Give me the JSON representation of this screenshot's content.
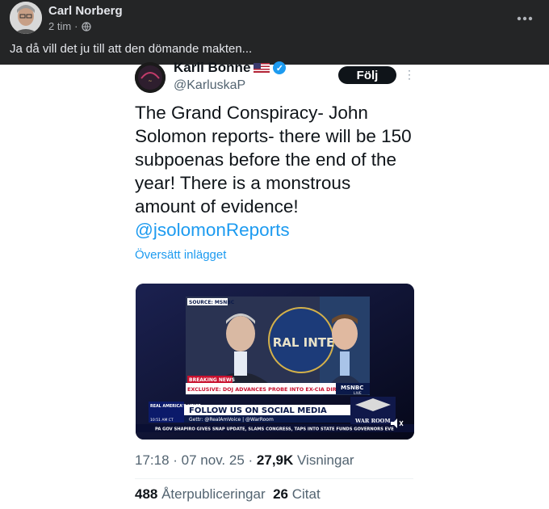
{
  "post": {
    "author": "Carl Norberg",
    "time": "2 tim",
    "separator": "·",
    "text": "Ja då vill det ju till att den dömande makten...",
    "more_icon": "more-horizontal-icon"
  },
  "tweet": {
    "display_name": "Karli Bonne",
    "handle": "@KarluskaP",
    "follow_label": "Följ",
    "body": "The Grand Conspiracy- John Solomon reports- there will be 150 subpoenas before the end of the year! There is a monstrous amount of evidence!",
    "mention": "@jsolomonReports",
    "translate_label": "Översätt inlägget",
    "timestamp": "17:18 · 07 nov. 25 · ",
    "views_count": "27,9K",
    "views_label": " Visningar",
    "reposts_count": "488",
    "reposts_label": " Återpubliceringar",
    "quotes_count": "26",
    "quotes_label": " Citat"
  },
  "video": {
    "source_tag": "SOURCE: MSNBC",
    "breaking_label": "BREAKING NEWS",
    "headline": "EXCLUSIVE: DOJ ADVANCES PROBE INTO EX-CIA DIR. BRENNAN",
    "network": "MSNBC",
    "live": "LIVE",
    "seal_text": "RAL INTE",
    "brand": "REAL AMERICA'S VOICE",
    "time_tag": "10:51 AM CT",
    "social_banner": "FOLLOW US ON SOCIAL MEDIA",
    "social_handles": "Gettr: @RealAmVoice | @WarRoom",
    "ticker": "PA GOV SHAPIRO GIVES SNAP UPDATE, SLAMS CONGRESS, TAPS INTO STATE FUNDS   GOVERNORS EVE",
    "warroom": "WAR ROOM"
  },
  "colors": {
    "fb_bg": "#242526",
    "link": "#1d9bf0",
    "text": "#0f1419",
    "muted": "#536471"
  }
}
